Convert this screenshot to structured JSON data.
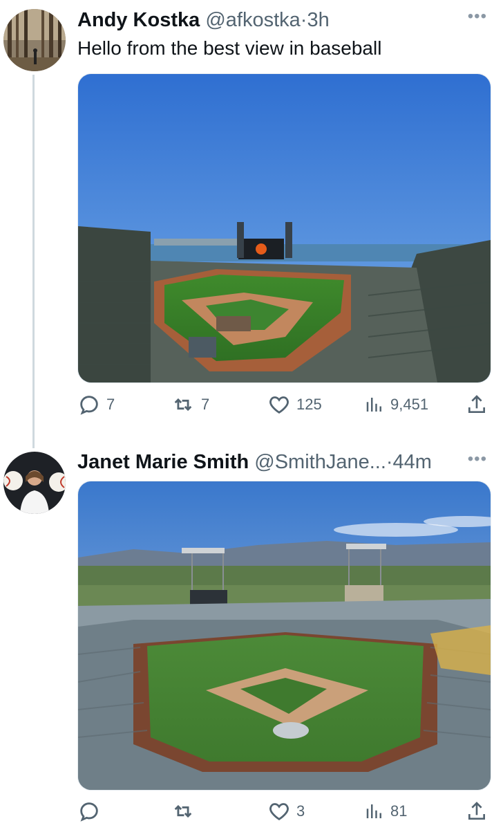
{
  "tweets": [
    {
      "name": "Andy Kostka",
      "handle": "@afkostka",
      "separator": "·",
      "time": "3h",
      "text": "Hello from the best view in baseball",
      "image_description": "Oracle Park stadium view overlooking the bay",
      "stats": {
        "replies": "7",
        "reposts": "7",
        "likes": "125",
        "views": "9,451"
      }
    },
    {
      "name": "Janet Marie Smith",
      "handle": "@SmithJane...",
      "separator": "·",
      "time": "44m",
      "text": "",
      "image_description": "Dodger Stadium view with mountains",
      "stats": {
        "replies": "",
        "reposts": "",
        "likes": "3",
        "views": "81"
      }
    }
  ],
  "icons": [
    "more-icon",
    "reply-icon",
    "repost-icon",
    "like-icon",
    "views-icon",
    "share-icon"
  ],
  "colors": {
    "text": "#0f1419",
    "secondary": "#536471",
    "thread_line": "#cfd9de"
  }
}
